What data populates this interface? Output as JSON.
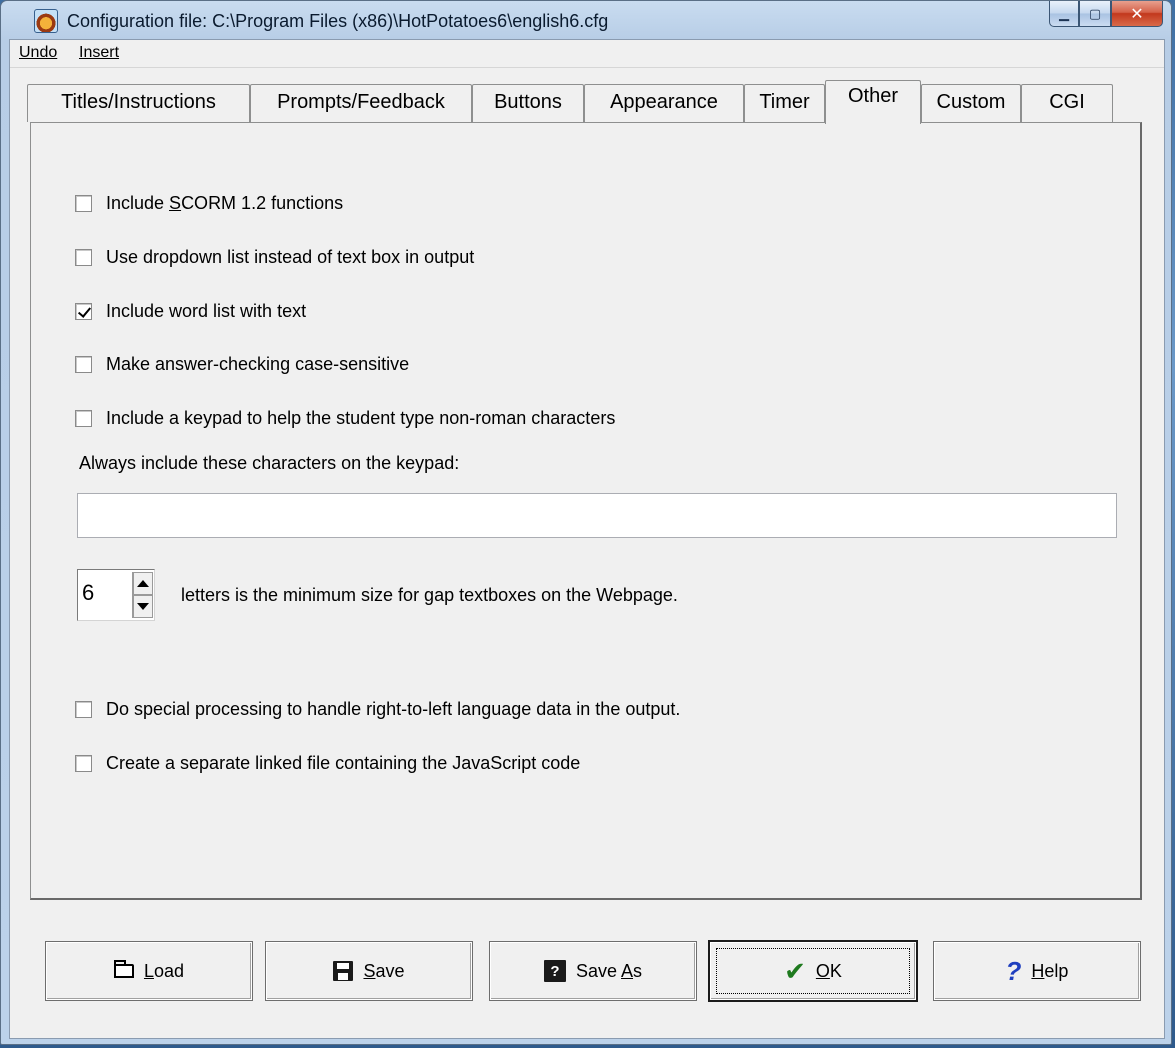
{
  "window": {
    "title": "Configuration file: C:\\Program Files (x86)\\HotPotatoes6\\english6.cfg",
    "icon": "hot-potatoes-icon"
  },
  "menu": {
    "undo": "Undo",
    "insert": "Insert"
  },
  "tabs": [
    {
      "label": "Titles/Instructions",
      "active": false
    },
    {
      "label": "Prompts/Feedback",
      "active": false
    },
    {
      "label": "Buttons",
      "active": false
    },
    {
      "label": "Appearance",
      "active": false
    },
    {
      "label": "Timer",
      "active": false
    },
    {
      "label": "Other",
      "active": true
    },
    {
      "label": "Custom",
      "active": false
    },
    {
      "label": "CGI",
      "active": false
    }
  ],
  "options": {
    "scorm": {
      "pre": "Include ",
      "accel": "S",
      "post": "CORM 1.2 functions",
      "checked": false
    },
    "dropdown": {
      "label": "Use dropdown list instead of text box in output",
      "checked": false
    },
    "wordlist": {
      "label": "Include word list with text",
      "checked": true
    },
    "casesensitive": {
      "label": "Make answer-checking case-sensitive",
      "checked": false
    },
    "keypad": {
      "label": "Include a keypad to help the student type non-roman characters",
      "checked": false
    },
    "rtl": {
      "label": "Do special processing to handle right-to-left language data in the output.",
      "checked": false
    },
    "linkedjs": {
      "label": "Create a separate linked file containing the JavaScript code",
      "checked": false
    }
  },
  "keypad_chars": {
    "label": "Always include these characters on the keypad:",
    "value": ""
  },
  "gap_size": {
    "value": "6",
    "label": "letters is the minimum size for gap textboxes on the Webpage."
  },
  "buttons": {
    "load": {
      "accel": "L",
      "rest": "oad",
      "icon": "open-folder-icon"
    },
    "save": {
      "accel": "S",
      "rest": "ave",
      "icon": "save-disk-icon"
    },
    "saveas": {
      "pre": "Save ",
      "accel": "A",
      "rest": "s",
      "icon": "save-as-icon"
    },
    "ok": {
      "accel": "O",
      "rest": "K",
      "icon": "checkmark-icon"
    },
    "help": {
      "accel": "H",
      "rest": "elp",
      "icon": "question-mark-icon"
    }
  }
}
